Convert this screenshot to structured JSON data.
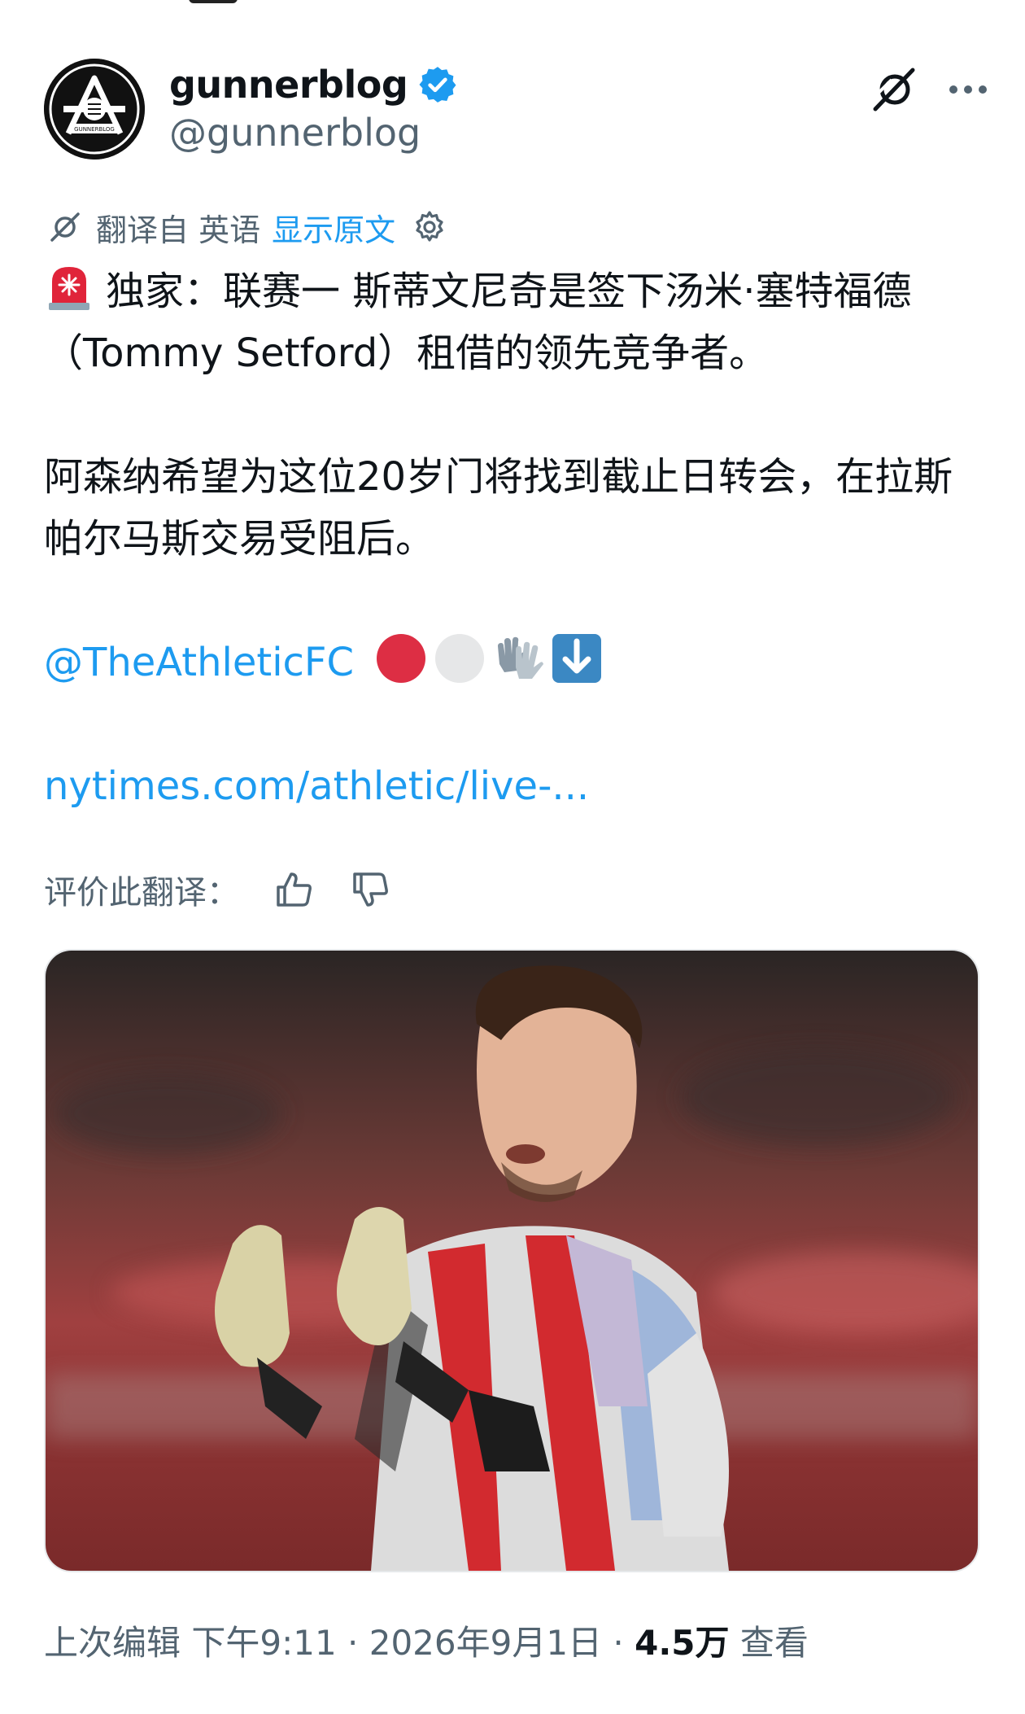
{
  "author": {
    "display_name": "gunnerblog",
    "handle": "@gunnerblog",
    "verified_icon": "verified-badge-icon",
    "avatar_text": "GUNNERBLOG"
  },
  "actions": {
    "grok_icon": "grok-icon",
    "more_icon": "more-horizontal-icon"
  },
  "translation": {
    "label": "翻译自 英语",
    "show_original": "显示原文",
    "settings_icon": "gear-icon"
  },
  "tweet": {
    "line1": "独家：联赛一 斯蒂文尼奇是签下汤米·塞特福德（Tommy Setford）租借的领先竞争者。",
    "line2": "阿森纳希望为这位20岁门将找到截止日转会，在拉斯帕尔马斯交易受阻后。",
    "mention": "@TheAthleticFC",
    "link": "nytimes.com/athletic/live-..."
  },
  "rating": {
    "label": "评价此翻译："
  },
  "footer": {
    "edited": "上次编辑 下午9:11 · 2026年9月1日 · ",
    "views_count": "4.5万",
    "views_label": " 查看"
  },
  "colors": {
    "accent": "#1d9bf0",
    "secondary_text": "#536471",
    "primary_text": "#0f1419"
  }
}
